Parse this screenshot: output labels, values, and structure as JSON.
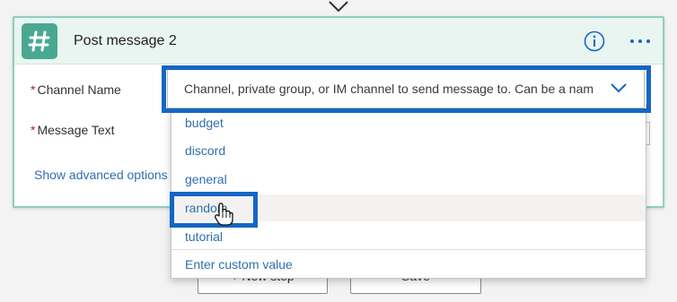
{
  "card": {
    "title": "Post message 2",
    "channel_label": "Channel Name",
    "message_label": "Message Text",
    "required_marker": "*",
    "advanced_link": "Show advanced options"
  },
  "channel_select": {
    "placeholder": "Channel, private group, or IM channel to send message to. Can be a nam"
  },
  "dropdown": {
    "items": [
      {
        "label": "budget"
      },
      {
        "label": "discord"
      },
      {
        "label": "general"
      },
      {
        "label": "random",
        "hovered": true
      },
      {
        "label": "tutorial"
      }
    ],
    "custom_value": "Enter custom value"
  },
  "background_buttons": {
    "new_step": "+ New step",
    "save": "Save"
  },
  "icons": {
    "connector": "slack-icon",
    "info": "info-icon",
    "more": "more-options-icon",
    "chevron": "chevron-down-icon",
    "cursor": "hand-cursor-icon",
    "flow_arrow": "arrow-down-icon"
  },
  "colors": {
    "highlight": "#1466c4",
    "link": "#2f6fad",
    "header_bg": "#e9f5f1",
    "slack_green": "#4aa891"
  }
}
